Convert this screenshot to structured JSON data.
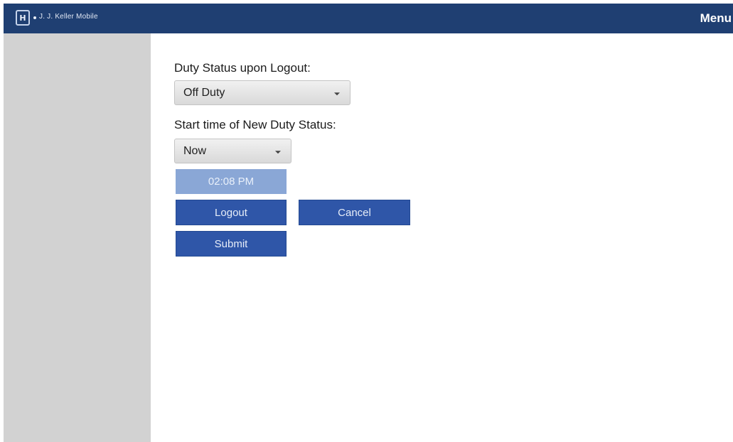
{
  "header": {
    "logo_glyph": "H",
    "app_title": "J. J. Keller Mobile",
    "menu_label": "Menu"
  },
  "form": {
    "duty_status_label": "Duty Status upon Logout:",
    "duty_status_value": "Off Duty",
    "start_time_label": "Start time of New Duty Status:",
    "start_time_value": "Now",
    "time_value": "02:08 PM"
  },
  "buttons": {
    "logout": "Logout",
    "cancel": "Cancel",
    "submit": "Submit"
  },
  "colors": {
    "header_bg": "#1f3f72",
    "sidebar_bg": "#d2d2d2",
    "button_bg": "#2f56a8",
    "time_field_bg": "#8aa7d6"
  },
  "icons": {
    "logo": "jj-keller-logo-icon",
    "dropdown_caret": "chevron-down-icon"
  }
}
